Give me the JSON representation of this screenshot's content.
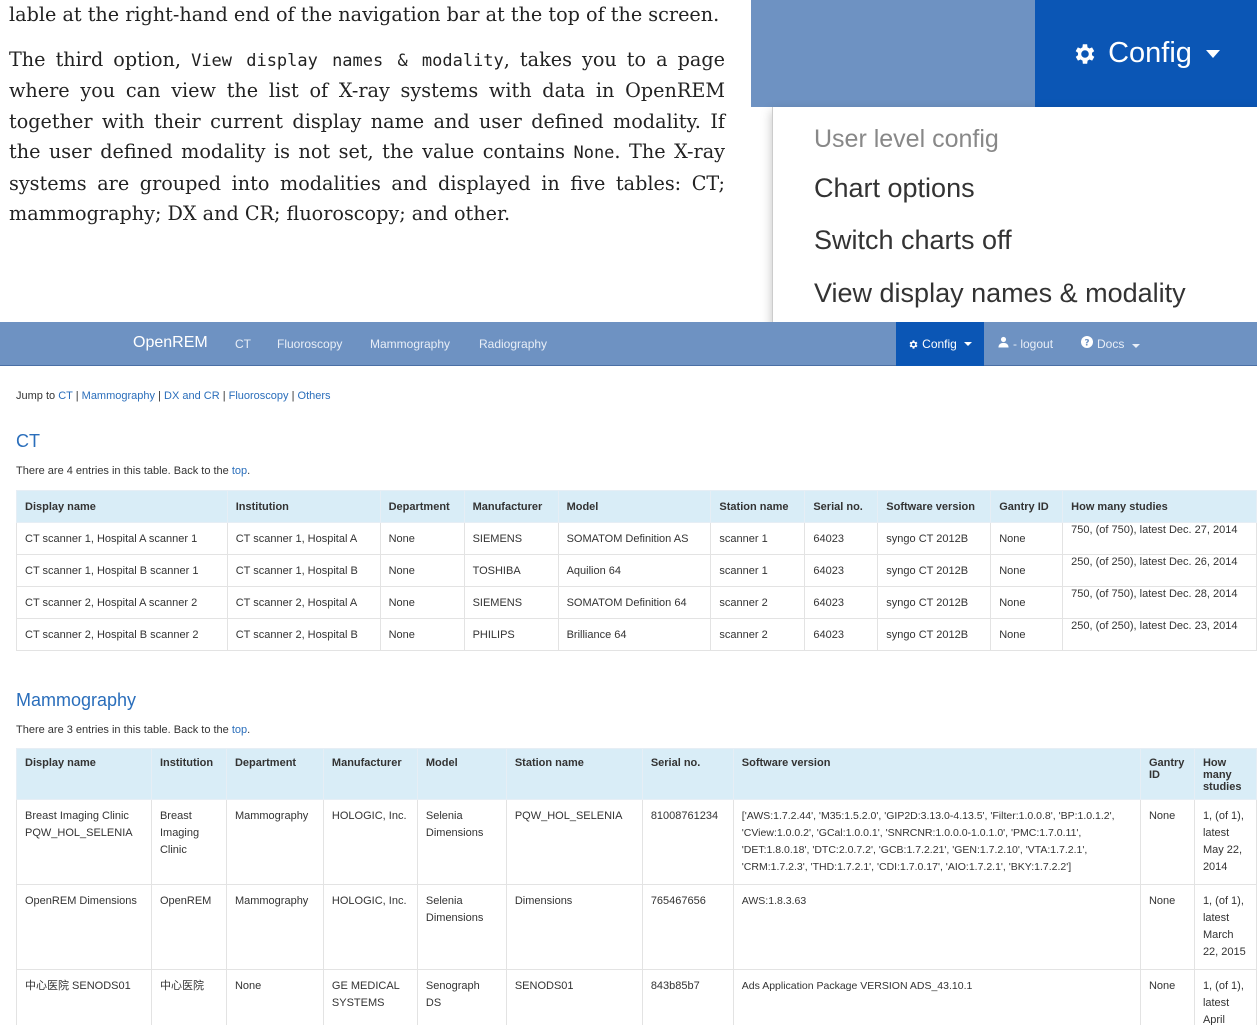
{
  "doc": {
    "line1": "lable at the right-hand end of the navigation bar at the top of the screen.",
    "para_pre": "The third option, ",
    "para_code": "View display names & modality",
    "para_mid": ", takes you to a page where you can view the list of X-ray systems with data in OpenREM together with their current display name and user defined modality. If the user defined modality is not set, the value contains ",
    "para_code2": "None",
    "para_post": ". The X-ray systems are grouped into modalities and displayed in five tables: CT; mammography; DX and CR; fluoroscopy; and other."
  },
  "zoom": {
    "config_label": "Config",
    "menu_items": [
      "User level config",
      "Chart options",
      "Switch charts off",
      "View display names & modality"
    ]
  },
  "navbar": {
    "brand": "OpenREM",
    "links": [
      "CT",
      "Fluoroscopy",
      "Mammography",
      "Radiography"
    ],
    "config_label": "Config",
    "logout_label": "- logout",
    "docs_label": "Docs"
  },
  "jump": {
    "prefix": "Jump to",
    "links": [
      "CT",
      "Mammography",
      "DX and CR",
      "Fluoroscopy",
      "Others"
    ]
  },
  "ct": {
    "title": "CT",
    "info_pre": "There are 4 entries in this table. Back to the",
    "info_link": "top",
    "headers": [
      "Display name",
      "Institution",
      "Department",
      "Manufacturer",
      "Model",
      "Station name",
      "Serial no.",
      "Software version",
      "Gantry ID",
      "How many studies"
    ],
    "rows": [
      [
        "CT scanner 1, Hospital A scanner 1",
        "CT scanner 1, Hospital A",
        "None",
        "SIEMENS",
        "SOMATOM Definition AS",
        "scanner 1",
        "64023",
        "syngo CT 2012B",
        "None",
        "750, (of 750), latest Dec. 27, 2014"
      ],
      [
        "CT scanner 1, Hospital B scanner 1",
        "CT scanner 1, Hospital B",
        "None",
        "TOSHIBA",
        "Aquilion 64",
        "scanner 1",
        "64023",
        "syngo CT 2012B",
        "None",
        "250, (of 250), latest Dec. 26, 2014"
      ],
      [
        "CT scanner 2, Hospital A scanner 2",
        "CT scanner 2, Hospital A",
        "None",
        "SIEMENS",
        "SOMATOM Definition 64",
        "scanner 2",
        "64023",
        "syngo CT 2012B",
        "None",
        "750, (of 750), latest Dec. 28, 2014"
      ],
      [
        "CT scanner 2, Hospital B scanner 2",
        "CT scanner 2, Hospital B",
        "None",
        "PHILIPS",
        "Brilliance 64",
        "scanner 2",
        "64023",
        "syngo CT 2012B",
        "None",
        "250, (of 250), latest Dec. 23, 2014"
      ]
    ]
  },
  "mammo": {
    "title": "Mammography",
    "info_pre": "There are 3 entries in this table. Back to the",
    "info_link": "top",
    "headers": [
      "Display name",
      "Institution",
      "Department",
      "Manufacturer",
      "Model",
      "Station name",
      "Serial no.",
      "Software version",
      "Gantry ID",
      "How many studies"
    ],
    "rows": [
      [
        "Breast Imaging Clinic PQW_HOL_SELENIA",
        "Breast Imaging Clinic",
        "Mammography",
        "HOLOGIC, Inc.",
        "Selenia Dimensions",
        "PQW_HOL_SELENIA",
        "81008761234",
        "['AWS:1.7.2.44', 'M35:1.5.2.0', 'GIP2D:3.13.0-4.13.5', 'Filter:1.0.0.8', 'BP:1.0.1.2', 'CView:1.0.0.2', 'GCal:1.0.0.1', 'SNRCNR:1.0.0.0-1.0.1.0', 'PMC:1.7.0.11', 'DET:1.8.0.18', 'DTC:2.0.7.2', 'GCB:1.7.2.21', 'GEN:1.7.2.10', 'VTA:1.7.2.1', 'CRM:1.7.2.3', 'THD:1.7.2.1', 'CDI:1.7.0.17', 'AIO:1.7.2.1', 'BKY:1.7.2.2']",
        "None",
        "1, (of 1), latest May 22, 2014"
      ],
      [
        "OpenREM Dimensions",
        "OpenREM",
        "Mammography",
        "HOLOGIC, Inc.",
        "Selenia Dimensions",
        "Dimensions",
        "765467656",
        "AWS:1.8.3.63",
        "None",
        "1, (of 1), latest March 22, 2015"
      ],
      [
        "中心医院 SENODS01",
        "中心医院",
        "None",
        "GE MEDICAL SYSTEMS",
        "Senograph DS",
        "SENODS01",
        "843b85b7",
        "Ads Application Package VERSION ADS_43.10.1",
        "None",
        "1, (of 1), latest April"
      ]
    ]
  }
}
